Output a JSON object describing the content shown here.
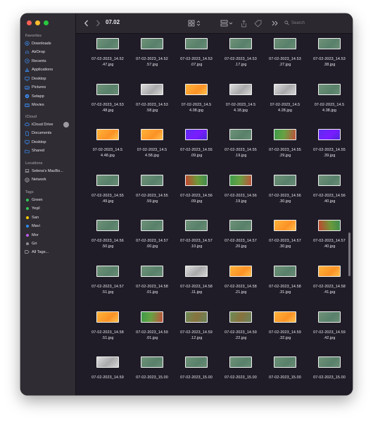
{
  "window": {
    "traffic_colors": [
      "#ff5f57",
      "#febc2e",
      "#28c840"
    ],
    "title": "07.02"
  },
  "sidebar": {
    "favorites_title": "Favorites",
    "favorites": [
      {
        "label": "Downloads",
        "icon": "download-icon"
      },
      {
        "label": "AirDrop",
        "icon": "airdrop-icon"
      },
      {
        "label": "Recents",
        "icon": "clock-icon"
      },
      {
        "label": "Applications",
        "icon": "applications-icon"
      },
      {
        "label": "Desktop",
        "icon": "desktop-icon"
      },
      {
        "label": "Pictures",
        "icon": "pictures-icon"
      },
      {
        "label": "Setapp",
        "icon": "setapp-icon"
      },
      {
        "label": "Movies",
        "icon": "movies-icon"
      }
    ],
    "icloud_title": "iCloud",
    "icloud": [
      {
        "label": "iCloud Drive",
        "icon": "cloud-icon"
      },
      {
        "label": "Documents",
        "icon": "document-icon"
      },
      {
        "label": "Desktop",
        "icon": "desktop-icon"
      },
      {
        "label": "Shared",
        "icon": "shared-folder-icon"
      }
    ],
    "locations_title": "Locations",
    "locations": [
      {
        "label": "Selena's MacBo...",
        "icon": "laptop-icon"
      },
      {
        "label": "Network",
        "icon": "network-icon"
      }
    ],
    "tags_title": "Tags",
    "tags": [
      {
        "label": "Green",
        "color": "#34c759"
      },
      {
        "label": "Yeşil",
        "color": "#34c759"
      },
      {
        "label": "Sarı",
        "color": "#ffcc00"
      },
      {
        "label": "Mavi",
        "color": "#2e8cf6"
      },
      {
        "label": "Mor",
        "color": "#bf5af2"
      },
      {
        "label": "Gri",
        "color": "#8e8e93"
      }
    ],
    "all_tags": "All Tags..."
  },
  "toolbar": {
    "search_placeholder": "Search"
  },
  "files": [
    {
      "name": "07-02-2023_14.52\n.47.jpg",
      "color": "green"
    },
    {
      "name": "07-02-2023_14.52\n.57.jpg",
      "color": "green"
    },
    {
      "name": "07-02-2023_14.53\n.07.jpg",
      "color": "green"
    },
    {
      "name": "07-02-2023_14.53\n.17.jpg",
      "color": "green"
    },
    {
      "name": "07-02-2023_14.53\n.27.jpg",
      "color": "green"
    },
    {
      "name": "07-02-2023_14.53\n.38.jpg",
      "color": "green"
    },
    {
      "name": "07-02-2023_14.53\n.48.jpg",
      "color": "green"
    },
    {
      "name": "07-02-2023_14.53\n.58.jpg",
      "color": "gray"
    },
    {
      "name": "07-02-2023_14.5\n4.08.jpg",
      "color": "orange"
    },
    {
      "name": "07-02-2023_14.5\n4.18.jpg",
      "color": "gray"
    },
    {
      "name": "07-02-2023_14.5\n4.28.jpg",
      "color": "gray"
    },
    {
      "name": "07-02-2023_14.5\n4.38.jpg",
      "color": "green"
    },
    {
      "name": "07-02-2023_14.5\n4.48.jpg",
      "color": "orange"
    },
    {
      "name": "07-02-2023_14.5\n4.58.jpg",
      "color": "orange"
    },
    {
      "name": "07-02-2023_14.55\n.09.jpg",
      "color": "purple"
    },
    {
      "name": "07-02-2023_14.55\n.19.jpg",
      "color": "green"
    },
    {
      "name": "07-02-2023_14.55\n.29.jpg",
      "color": "mixed"
    },
    {
      "name": "07-02-2023_14.55\n.39.jpg",
      "color": "purple"
    },
    {
      "name": "07-02-2023_14.55\n.49.jpg",
      "color": "green"
    },
    {
      "name": "07-02-2023_14.55\n.59.jpg",
      "color": "green"
    },
    {
      "name": "07-02-2023_14.56\n.09.jpg",
      "color": "mixed2"
    },
    {
      "name": "07-02-2023_14.56\n.19.jpg",
      "color": "mixed"
    },
    {
      "name": "07-02-2023_14.56\n.30.jpg",
      "color": "green"
    },
    {
      "name": "07-02-2023_14.56\n.40.jpg",
      "color": "green"
    },
    {
      "name": "07-02-2023_14.56\n.50.jpg",
      "color": "green"
    },
    {
      "name": "07-02-2023_14.57\n.00.jpg",
      "color": "green"
    },
    {
      "name": "07-02-2023_14.57\n.10.jpg",
      "color": "green"
    },
    {
      "name": "07-02-2023_14.57\n.20.jpg",
      "color": "green"
    },
    {
      "name": "07-02-2023_14.57\n.30.jpg",
      "color": "orange"
    },
    {
      "name": "07-02-2023_14.57\n.40.jpg",
      "color": "mixed2"
    },
    {
      "name": "07-02-2023_14.57\n.51.jpg",
      "color": "green"
    },
    {
      "name": "07-02-2023_14.58\n.01.jpg",
      "color": "green"
    },
    {
      "name": "07-02-2023_14.58\n.11.jpg",
      "color": "gray"
    },
    {
      "name": "07-02-2023_14.58\n.21.jpg",
      "color": "orange"
    },
    {
      "name": "07-02-2023_14.58\n.31.jpg",
      "color": "green"
    },
    {
      "name": "07-02-2023_14.58\n.41.jpg",
      "color": "orange"
    },
    {
      "name": "07-02-2023_14.58\n.51.jpg",
      "color": "orange"
    },
    {
      "name": "07-02-2023_14.59\n.01.jpg",
      "color": "mixed"
    },
    {
      "name": "07-02-2023_14.59\n.12.jpg",
      "color": "brown"
    },
    {
      "name": "07-02-2023_14.59\n.22.jpg",
      "color": "brown"
    },
    {
      "name": "07-02-2023_14.59\n.32.jpg",
      "color": "orange"
    },
    {
      "name": "07-02-2023_14.59\n.42.jpg",
      "color": "green"
    },
    {
      "name": "07-02-2023_14.59",
      "color": "gray"
    },
    {
      "name": "07-02-2023_15.00",
      "color": "green"
    },
    {
      "name": "07-02-2023_15.00",
      "color": "green"
    },
    {
      "name": "07-02-2023_15.00",
      "color": "green"
    },
    {
      "name": "07-02-2023_15.00",
      "color": "green"
    },
    {
      "name": "07-02-2023_15.00",
      "color": "green"
    }
  ]
}
